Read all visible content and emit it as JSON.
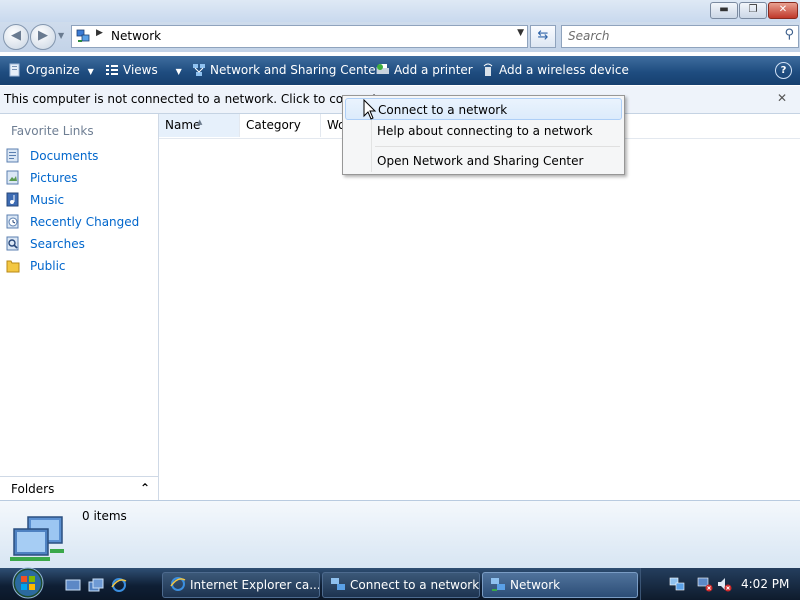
{
  "window": {
    "title_buttons": {
      "minimize": "▬",
      "maximize": "❐",
      "close": "✕"
    }
  },
  "address_bar": {
    "location": "Network",
    "search_placeholder": "Search"
  },
  "toolbar": {
    "organize": "Organize",
    "views": "Views",
    "network_center": "Network and Sharing Center",
    "add_printer": "Add a printer",
    "add_wireless": "Add a wireless device",
    "help": "?"
  },
  "info_bar": {
    "text": "This computer is not connected to a network. Click to connect...",
    "close": "✕"
  },
  "left_pane": {
    "title": "Favorite Links",
    "links": [
      {
        "label": "Documents",
        "icon": "documents-icon"
      },
      {
        "label": "Pictures",
        "icon": "pictures-icon"
      },
      {
        "label": "Music",
        "icon": "music-icon"
      },
      {
        "label": "Recently Changed",
        "icon": "recently-changed-icon"
      },
      {
        "label": "Searches",
        "icon": "searches-icon"
      },
      {
        "label": "Public",
        "icon": "public-folder-icon"
      }
    ],
    "folders_label": "Folders"
  },
  "columns": {
    "name": "Name",
    "category": "Category",
    "workgroup": "Wo"
  },
  "context_menu": {
    "items": [
      {
        "label": "Connect to a network"
      },
      {
        "label": "Help about connecting to a network"
      },
      {
        "label": "Open Network and Sharing Center"
      }
    ]
  },
  "details": {
    "count": "0 items"
  },
  "taskbar": {
    "tasks": [
      {
        "label": "Internet Explorer ca..."
      },
      {
        "label": "Connect to a network"
      },
      {
        "label": "Network"
      }
    ],
    "clock": "4:02 PM"
  },
  "colors": {
    "toolbar": "#1f4d80",
    "link": "#0066cc",
    "taskbar": "#0f1f35"
  }
}
